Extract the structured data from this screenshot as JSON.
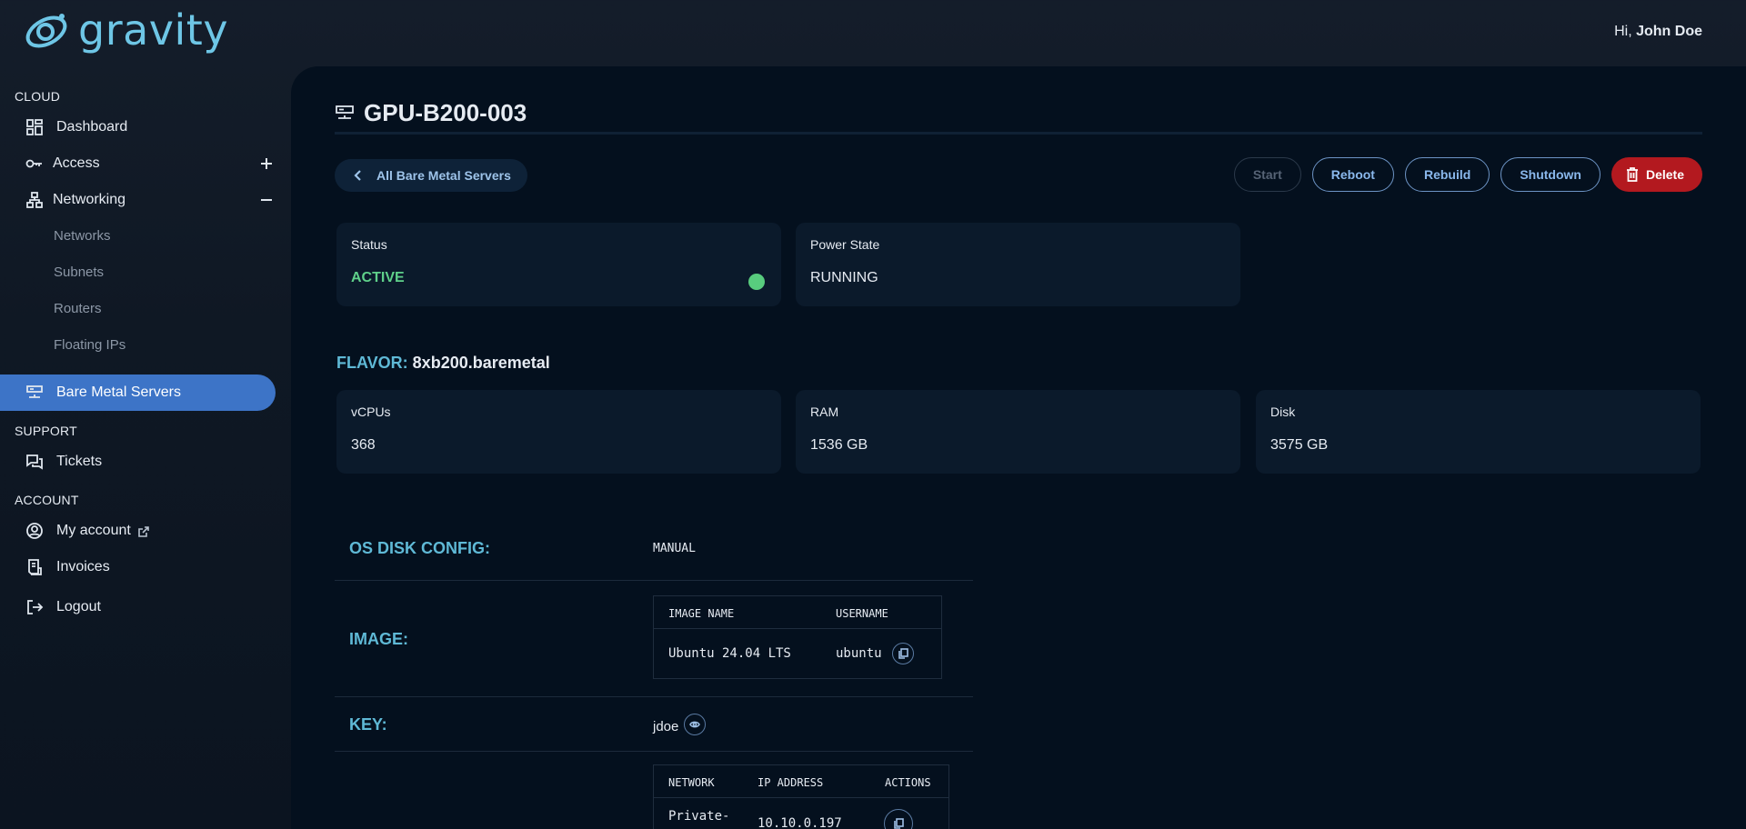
{
  "app": {
    "logo_text": "gravity"
  },
  "header": {
    "greeting_prefix": "Hi,",
    "user_name": "John Doe"
  },
  "sidebar": {
    "cloud_title": "CLOUD",
    "dashboard": "Dashboard",
    "access": "Access",
    "networking": "Networking",
    "networking_sub": [
      "Networks",
      "Subnets",
      "Routers",
      "Floating IPs"
    ],
    "bare_metal": "Bare Metal Servers",
    "support_title": "SUPPORT",
    "tickets": "Tickets",
    "account_title": "ACCOUNT",
    "my_account": "My account",
    "invoices": "Invoices",
    "logout": "Logout"
  },
  "page": {
    "title": "GPU-B200-003",
    "back_label": "All Bare Metal Servers"
  },
  "actions": {
    "start": "Start",
    "reboot": "Reboot",
    "rebuild": "Rebuild",
    "shutdown": "Shutdown",
    "delete": "Delete"
  },
  "status": {
    "label": "Status",
    "value": "ACTIVE",
    "color": "#5fd08a"
  },
  "power": {
    "label": "Power State",
    "value": "RUNNING"
  },
  "flavor": {
    "key": "FLAVOR:",
    "name": "8xb200.baremetal",
    "vcpus_label": "vCPUs",
    "vcpus": "368",
    "ram_label": "RAM",
    "ram": "1536 GB",
    "disk_label": "Disk",
    "disk": "3575 GB"
  },
  "config": {
    "os_disk_key": "OS DISK CONFIG:",
    "os_disk_value": "MANUAL",
    "image_key": "IMAGE:",
    "image_headers": [
      "IMAGE NAME",
      "USERNAME"
    ],
    "image_name": "Ubuntu 24.04 LTS",
    "image_username": "ubuntu",
    "key_key": "KEY:",
    "key_value": "jdoe",
    "network_headers": [
      "NETWORK",
      "IP ADDRESS",
      "ACTIONS"
    ],
    "network_name": "Private-",
    "network_ip": "10.10.0.197"
  }
}
